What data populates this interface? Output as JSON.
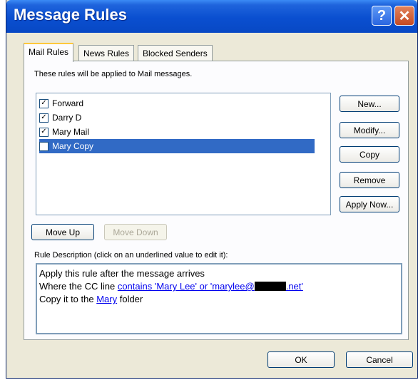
{
  "window": {
    "title": "Message Rules",
    "help_glyph": "?",
    "close_glyph": "✕"
  },
  "tabs": [
    {
      "label": "Mail Rules",
      "active": true
    },
    {
      "label": "News Rules",
      "active": false
    },
    {
      "label": "Blocked Senders",
      "active": false
    }
  ],
  "mail_rules": {
    "caption": "These rules will be applied to Mail messages.",
    "rules": [
      {
        "label": "Forward",
        "checked": true,
        "selected": false
      },
      {
        "label": "Darry D",
        "checked": true,
        "selected": false
      },
      {
        "label": "Mary Mail",
        "checked": true,
        "selected": false
      },
      {
        "label": "Mary Copy",
        "checked": true,
        "selected": true
      }
    ],
    "check_glyph": "✓",
    "buttons": {
      "new": "New...",
      "modify": "Modify...",
      "copy": "Copy",
      "remove": "Remove",
      "apply_now": "Apply Now...",
      "move_up": "Move Up",
      "move_down": "Move Down"
    },
    "description_caption": "Rule Description (click on an underlined value to edit it):",
    "description": {
      "line1": "Apply this rule after the message arrives",
      "line2_prefix": "Where the CC line ",
      "line2_link_a": "contains 'Mary Lee' or 'marylee@",
      "line2_link_b": ".net'",
      "line3_prefix": "Copy it to the ",
      "line3_link": "Mary",
      "line3_suffix": " folder"
    }
  },
  "footer": {
    "ok": "OK",
    "cancel": "Cancel"
  }
}
